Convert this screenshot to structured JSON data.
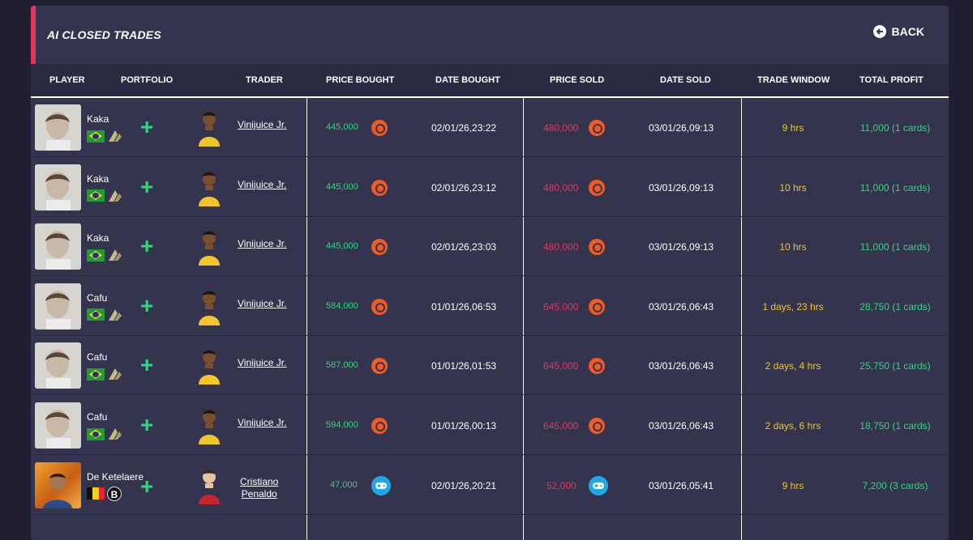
{
  "header": {
    "title": "AI CLOSED TRADES",
    "back_label": "BACK"
  },
  "columns": {
    "player": "PLAYER",
    "portfolio": "PORTFOLIO",
    "trader": "TRADER",
    "price_bought": "PRICE BOUGHT",
    "date_bought": "DATE BOUGHT",
    "price_sold": "PRICE SOLD",
    "date_sold": "DATE SOLD",
    "trade_window": "TRADE WINDOW",
    "total_profit": "TOTAL PROFIT"
  },
  "trades": [
    {
      "player": "Kaka",
      "nation": "brazil",
      "trader_line1": "Vinijuice Jr.",
      "trader_line2": "",
      "price_bought": "445,000",
      "date_bought": "02/01/26,23:22",
      "price_sold": "480,000",
      "date_sold": "03/01/26,09:13",
      "trade_window": "9 hrs",
      "total_profit": "11,000 (1 cards)",
      "platform": "origin"
    },
    {
      "player": "Kaka",
      "nation": "brazil",
      "trader_line1": "Vinijuice Jr.",
      "trader_line2": "",
      "price_bought": "445,000",
      "date_bought": "02/01/26,23:12",
      "price_sold": "480,000",
      "date_sold": "03/01/26,09:13",
      "trade_window": "10 hrs",
      "total_profit": "11,000 (1 cards)",
      "platform": "origin"
    },
    {
      "player": "Kaka",
      "nation": "brazil",
      "trader_line1": "Vinijuice Jr.",
      "trader_line2": "",
      "price_bought": "445,000",
      "date_bought": "02/01/26,23:03",
      "price_sold": "480,000",
      "date_sold": "03/01/26,09:13",
      "trade_window": "10 hrs",
      "total_profit": "11,000 (1 cards)",
      "platform": "origin"
    },
    {
      "player": "Cafu",
      "nation": "brazil",
      "trader_line1": "Vinijuice Jr.",
      "trader_line2": "",
      "price_bought": "584,000",
      "date_bought": "01/01/26,06:53",
      "price_sold": "645,000",
      "date_sold": "03/01/26,06:43",
      "trade_window": "1 days, 23 hrs",
      "total_profit": "28,750 (1 cards)",
      "platform": "origin"
    },
    {
      "player": "Cafu",
      "nation": "brazil",
      "trader_line1": "Vinijuice Jr.",
      "trader_line2": "",
      "price_bought": "587,000",
      "date_bought": "01/01/26,01:53",
      "price_sold": "645,000",
      "date_sold": "03/01/26,06:43",
      "trade_window": "2 days, 4 hrs",
      "total_profit": "25,750 (1 cards)",
      "platform": "origin"
    },
    {
      "player": "Cafu",
      "nation": "brazil",
      "trader_line1": "Vinijuice Jr.",
      "trader_line2": "",
      "price_bought": "594,000",
      "date_bought": "01/01/26,00:13",
      "price_sold": "645,000",
      "date_sold": "03/01/26,06:43",
      "trade_window": "2 days, 6 hrs",
      "total_profit": "18,750 (1 cards)",
      "platform": "origin"
    },
    {
      "player": "De Ketelaere",
      "nation": "belgium",
      "trader_line1": "Cristiano",
      "trader_line2": "Penaldo",
      "price_bought": "47,000",
      "date_bought": "02/01/26,20:21",
      "price_sold": "52,000",
      "date_sold": "03/01/26,05:41",
      "trade_window": "9 hrs",
      "total_profit": "7,200 (3 cards)",
      "platform": "console"
    }
  ],
  "colors": {
    "accent": "#e2365a",
    "profit": "#34d47e",
    "loss": "#e2365a",
    "window": "#f2c52b",
    "panel": "#34344f"
  },
  "icons": {
    "back": "arrow-left-circle-icon",
    "add": "plus-icon",
    "origin": "origin-coin-icon",
    "console": "gamepad-icon"
  }
}
